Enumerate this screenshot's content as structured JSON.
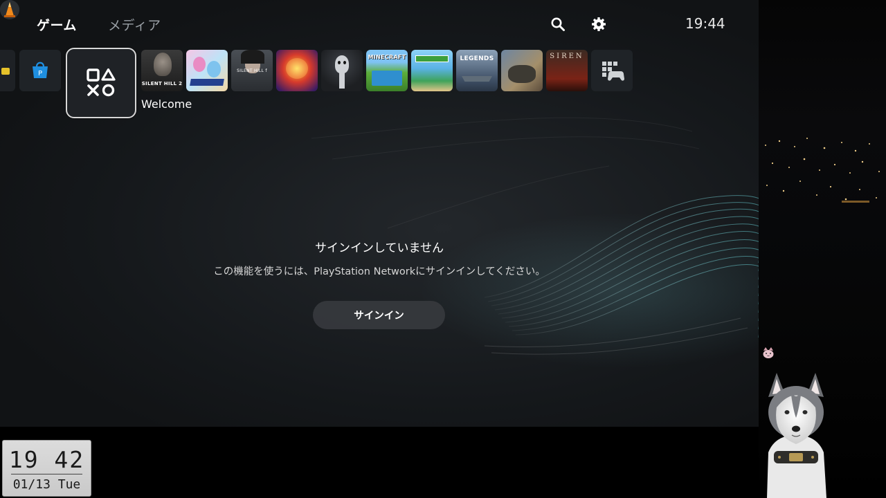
{
  "nav": {
    "tabs": [
      {
        "label": "ゲーム",
        "active": true
      },
      {
        "label": "メディア",
        "active": false
      }
    ],
    "icons": [
      "search-icon",
      "gear-icon",
      "avatar"
    ],
    "time": "19:44"
  },
  "tiles": {
    "focused": {
      "icon": "ps-symbols-icon",
      "label": "Welcome"
    },
    "items": [
      {
        "name": "silent-hill-2",
        "text": "SILENT HILL 2"
      },
      {
        "name": "anime-game",
        "text": ""
      },
      {
        "name": "silent-hill-f",
        "text": "SILENT HILL f"
      },
      {
        "name": "one-piece-game",
        "text": ""
      },
      {
        "name": "horror-game",
        "text": ""
      },
      {
        "name": "minecraft",
        "text": "MINECRAFT"
      },
      {
        "name": "minecraft-education",
        "text": ""
      },
      {
        "name": "world-of-warships-legends",
        "text": "LEGENDS"
      },
      {
        "name": "monster-hunter",
        "text": ""
      },
      {
        "name": "siren",
        "text": "SIREN"
      }
    ],
    "game_library_icon": "game-library-icon",
    "store_icon": "ps-store-icon"
  },
  "message": {
    "title": "サインインしていません",
    "body": "この機能を使うには、PlayStation Networkにサインインしてください。",
    "button": "サインイン"
  },
  "widget": {
    "time": "19 42",
    "date": "01/13 Tue"
  },
  "colors": {
    "accent_wave": "#5fd3d9",
    "background": "#15181b"
  }
}
